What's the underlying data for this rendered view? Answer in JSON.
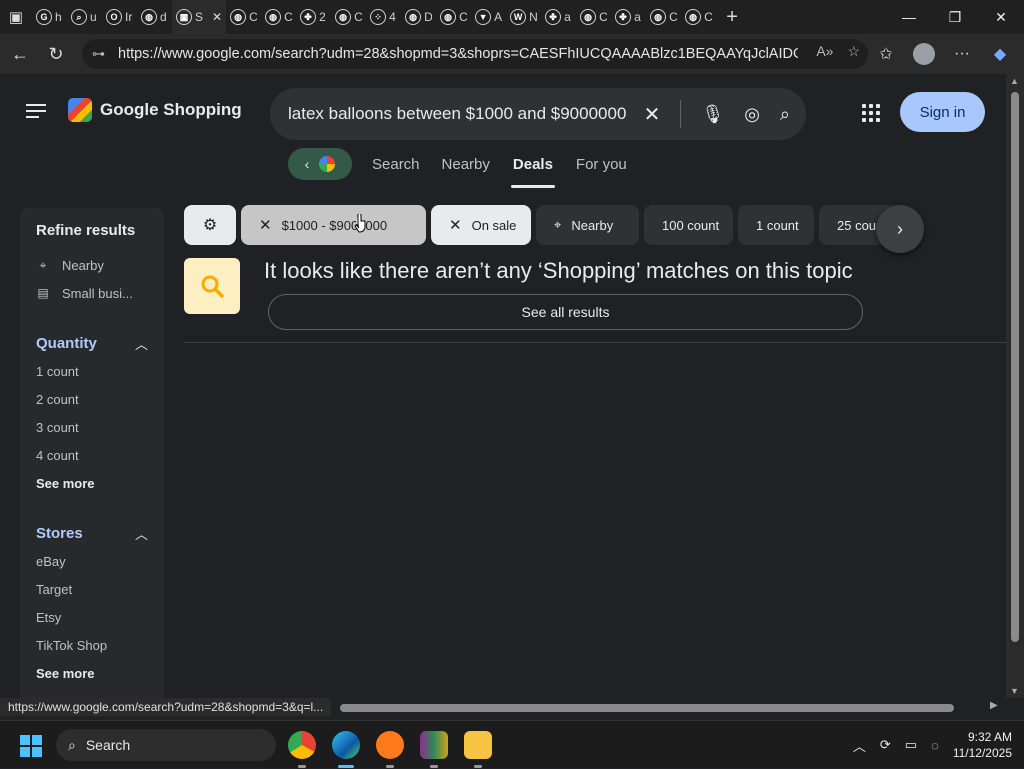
{
  "browser": {
    "tabs": [
      {
        "title": "h",
        "icon": "google-icon"
      },
      {
        "title": "u",
        "icon": "search-icon"
      },
      {
        "title": "Ir",
        "icon": "opera-icon"
      },
      {
        "title": "d",
        "icon": "globe-icon"
      },
      {
        "title": "S",
        "icon": "shopping-icon",
        "active": true
      },
      {
        "title": "C",
        "icon": "globe-icon"
      },
      {
        "title": "C",
        "icon": "globe-icon"
      },
      {
        "title": "2",
        "icon": "puzzle-icon"
      },
      {
        "title": "C",
        "icon": "globe-icon"
      },
      {
        "title": "4",
        "icon": "dots-icon"
      },
      {
        "title": "D",
        "icon": "globe-icon"
      },
      {
        "title": "C",
        "icon": "globe-icon"
      },
      {
        "title": "A",
        "icon": "vuetify-icon"
      },
      {
        "title": "N",
        "icon": "wordpress-icon"
      },
      {
        "title": "a",
        "icon": "puzzle-icon"
      },
      {
        "title": "C",
        "icon": "globe-icon"
      },
      {
        "title": "a",
        "icon": "puzzle-icon"
      },
      {
        "title": "C",
        "icon": "globe-icon"
      },
      {
        "title": "C",
        "icon": "globe-icon"
      }
    ],
    "url": "https://www.google.com/search?udm=28&shopmd=3&shoprs=CAESFhIUCQAAAABlzc1BEQAAYqJclAIDGAES...",
    "status_url": "https://www.google.com/search?udm=28&shopmd=3&q=l..."
  },
  "header": {
    "logo_text": "Google Shopping",
    "search_query": "latex balloons between $1000 and $9000000",
    "signin_label": "Sign in"
  },
  "nav": {
    "tabs": [
      "Search",
      "Nearby",
      "Deals",
      "For you"
    ],
    "active": "Deals"
  },
  "sidebar": {
    "title": "Refine results",
    "top_items": [
      {
        "label": "Nearby",
        "icon": "location-pin-icon"
      },
      {
        "label": "Small busi...",
        "icon": "storefront-icon"
      }
    ],
    "quantity": {
      "heading": "Quantity",
      "items": [
        "1 count",
        "2 count",
        "3 count",
        "4 count"
      ],
      "more": "See more"
    },
    "stores": {
      "heading": "Stores",
      "items": [
        "eBay",
        "Target",
        "Etsy",
        "TikTok Shop"
      ],
      "more": "See more"
    }
  },
  "chips": {
    "price": "$1000 - $9000000",
    "on_sale": "On sale",
    "nearby": "Nearby",
    "count_100": "100 count",
    "count_1": "1 count",
    "count_25": "25 cou"
  },
  "results": {
    "no_match": "It looks like there aren’t any ‘Shopping’ matches on this topic",
    "see_all": "See all results"
  },
  "taskbar": {
    "search_label": "Search",
    "time": "9:32 AM",
    "date": "11/12/2025"
  },
  "colors": {
    "page_bg": "#202124",
    "signin_bg": "#a8c7fa",
    "section_heading": "#aecbfa",
    "back_pill": "#335a49"
  }
}
